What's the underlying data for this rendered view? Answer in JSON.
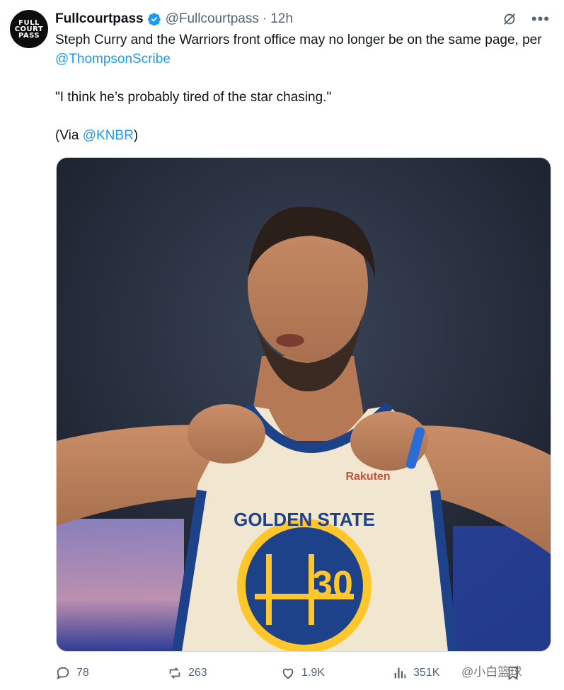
{
  "author": {
    "name": "Fullcourtpass",
    "handle": "@Fullcourtpass",
    "separator": "·",
    "time": "12h",
    "avatar_lines": [
      "FULL",
      "COURT",
      "PASS"
    ],
    "verified_color": "#1d9bf0"
  },
  "tweet": {
    "line1_text": "Steph Curry and the Warriors front office may no longer be on the same page, per ",
    "line1_mention": "@ThompsonScribe",
    "quote": "\"I think he’s probably tired of the star chasing.\"",
    "via_prefix": "(Via ",
    "via_mention": "@KNBR",
    "via_suffix": ")"
  },
  "media": {
    "jersey_team": "GOLDEN STATE",
    "jersey_number": "30",
    "sponsor": "Rakuten"
  },
  "actions": {
    "replies": "78",
    "reposts": "263",
    "likes": "1.9K",
    "views": "351K"
  },
  "watermark": "@小白篮球",
  "colors": {
    "link": "#1d9bf0",
    "muted": "#536471",
    "gsw_blue": "#1d428a",
    "gsw_gold": "#ffc72c"
  }
}
